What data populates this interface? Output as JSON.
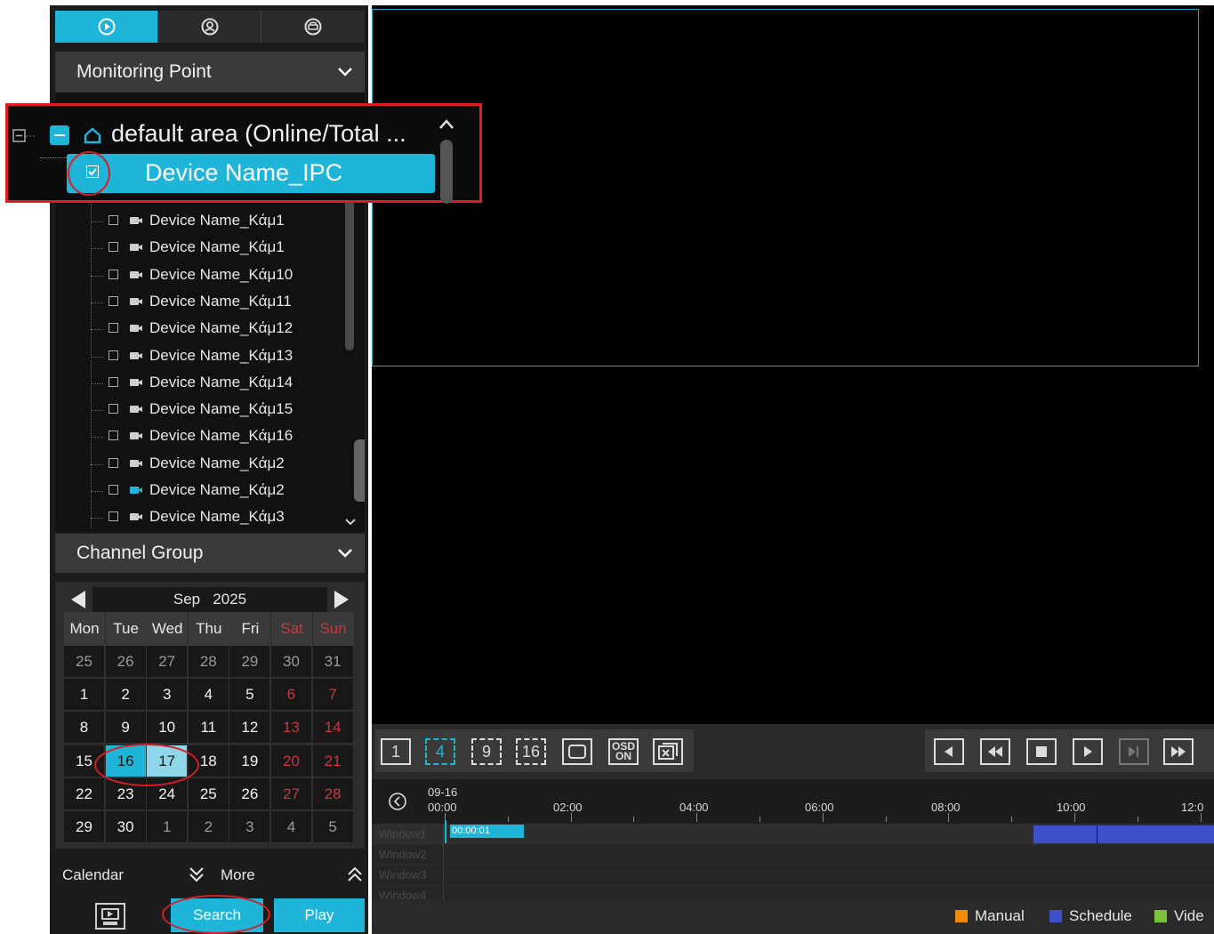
{
  "tabs": [
    {
      "name": "playback-tab",
      "icon": "play-circle-icon"
    },
    {
      "name": "face-tab",
      "icon": "face-icon"
    },
    {
      "name": "vehicle-tab",
      "icon": "car-icon"
    }
  ],
  "monitoring_point": {
    "label": "Monitoring Point"
  },
  "zoom_callout": {
    "area_label": "default area (Online/Total ...",
    "selected_device": "Device Name_IPC"
  },
  "device_list": [
    "Device Name_Κάμ1",
    "Device Name_Κάμ1",
    "Device Name_Κάμ10",
    "Device Name_Κάμ11",
    "Device Name_Κάμ12",
    "Device Name_Κάμ13",
    "Device Name_Κάμ14",
    "Device Name_Κάμ15",
    "Device Name_Κάμ16",
    "Device Name_Κάμ2",
    "Device Name_Κάμ2",
    "Device Name_Κάμ3"
  ],
  "channel_group": {
    "label": "Channel Group"
  },
  "calendar": {
    "month": "Sep",
    "year": "2025",
    "weekdays": [
      "Mon",
      "Tue",
      "Wed",
      "Thu",
      "Fri",
      "Sat",
      "Sun"
    ],
    "weeks": [
      [
        "25",
        "26",
        "27",
        "28",
        "29",
        "30",
        "31"
      ],
      [
        "1",
        "2",
        "3",
        "4",
        "5",
        "6",
        "7"
      ],
      [
        "8",
        "9",
        "10",
        "11",
        "12",
        "13",
        "14"
      ],
      [
        "15",
        "16",
        "17",
        "18",
        "19",
        "20",
        "21"
      ],
      [
        "22",
        "23",
        "24",
        "25",
        "26",
        "27",
        "28"
      ],
      [
        "29",
        "30",
        "1",
        "2",
        "3",
        "4",
        "5"
      ]
    ],
    "selected_days": [
      "16",
      "17"
    ]
  },
  "bottom_left": {
    "calendar_label": "Calendar",
    "more_label": "More",
    "search_label": "Search",
    "play_label": "Play"
  },
  "layout_buttons": [
    "1",
    "4",
    "9",
    "16"
  ],
  "osd": {
    "line1": "OSD",
    "line2": "ON"
  },
  "timeline": {
    "date": "09-16",
    "ticks": [
      "00:00",
      "02:00",
      "04:00",
      "06:00",
      "08:00",
      "10:00",
      "12:0"
    ],
    "windows": [
      "Window1",
      "Window2",
      "Window3",
      "Window4"
    ],
    "current_time": "00:00:01"
  },
  "legend": [
    {
      "label": "Manual",
      "color": "#f08c00"
    },
    {
      "label": "Schedule",
      "color": "#3f4fc8"
    },
    {
      "label": "Vide",
      "color": "#7cc23a"
    }
  ],
  "colors": {
    "accent": "#1fb5d9",
    "highlight": "#e01d22"
  }
}
